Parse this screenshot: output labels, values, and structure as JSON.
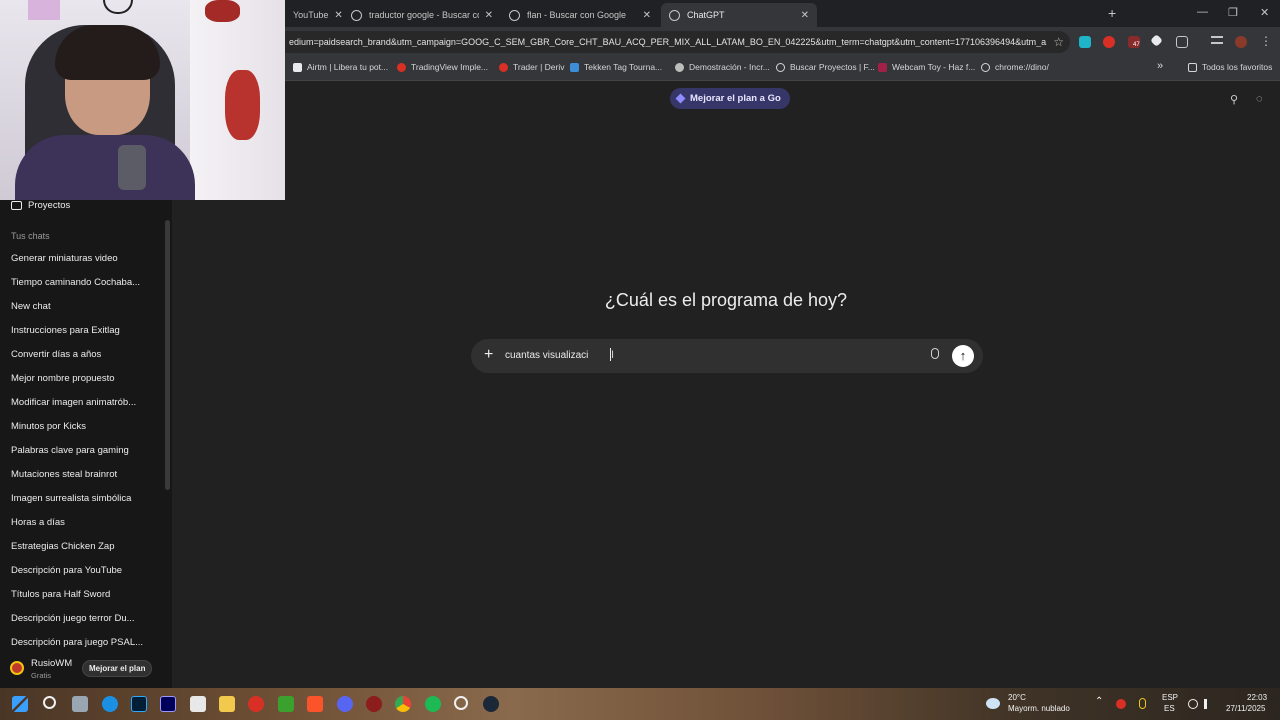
{
  "browser": {
    "tabs": [
      {
        "label": "YouTube",
        "active": false
      },
      {
        "label": "traductor google - Buscar con G",
        "active": false
      },
      {
        "label": "flan - Buscar con Google",
        "active": false
      },
      {
        "label": "ChatGPT",
        "active": true
      }
    ],
    "new_tab": "+",
    "window_controls": {
      "minimize": "—",
      "maximize": "❐",
      "close": "✕"
    },
    "url": "edium=paidsearch_brand&utm_campaign=GOOG_C_SEM_GBR_Core_CHT_BAU_ACQ_PER_MIX_ALL_LATAM_BO_EN_042225&utm_term=chatgpt&utm_content=177106396494&utm_a...",
    "bookmark_star": "☆",
    "extension_badge": "47",
    "bookmarks": [
      "Airtm | Libera tu pot...",
      "TradingView Imple...",
      "Trader | Deriv",
      "Tekken Tag Tourna...",
      "Demostración - Incr...",
      "Buscar Proyectos | F...",
      "Webcam Toy - Haz f...",
      "chrome://dino/"
    ],
    "bookmarks_overflow": "»",
    "all_favorites": "Todos los favoritos"
  },
  "sidebar": {
    "projects": "Proyectos",
    "section_title": "Tus chats",
    "chats": [
      "Generar miniaturas video",
      "Tiempo caminando Cochaba...",
      "New chat",
      "Instrucciones para Exitlag",
      "Convertir días a años",
      "Mejor nombre propuesto",
      "Modificar imagen animatrób...",
      "Minutos por Kicks",
      "Palabras clave para gaming",
      "Mutaciones steal brainrot",
      "Imagen surrealista simbólica",
      "Horas a días",
      "Estrategias Chicken Zap",
      "Descripción para YouTube",
      "Títulos para Half Sword",
      "Descripción juego terror Du...",
      "Descripción para juego PSAL..."
    ],
    "user": {
      "name": "RusioWM",
      "plan": "Gratis",
      "upgrade_label": "Mejorar el plan"
    }
  },
  "main": {
    "upgrade_pill": "Mejorar el plan a Go",
    "headline": "¿Cuál es el programa de hoy?",
    "composer": {
      "value": "cuantas visualizaci",
      "plus": "+",
      "send": "↑"
    }
  },
  "taskbar": {
    "weather_temp": "20°C",
    "weather_desc": "Mayorm. nublado",
    "lang_top": "ESP",
    "lang_bottom": "ES",
    "time": "22:03",
    "date": "27/11/2025"
  },
  "colors": {
    "accent_go": "#373669",
    "sidebar_bg": "#171717",
    "main_bg": "#212121",
    "composer_bg": "#303030"
  }
}
